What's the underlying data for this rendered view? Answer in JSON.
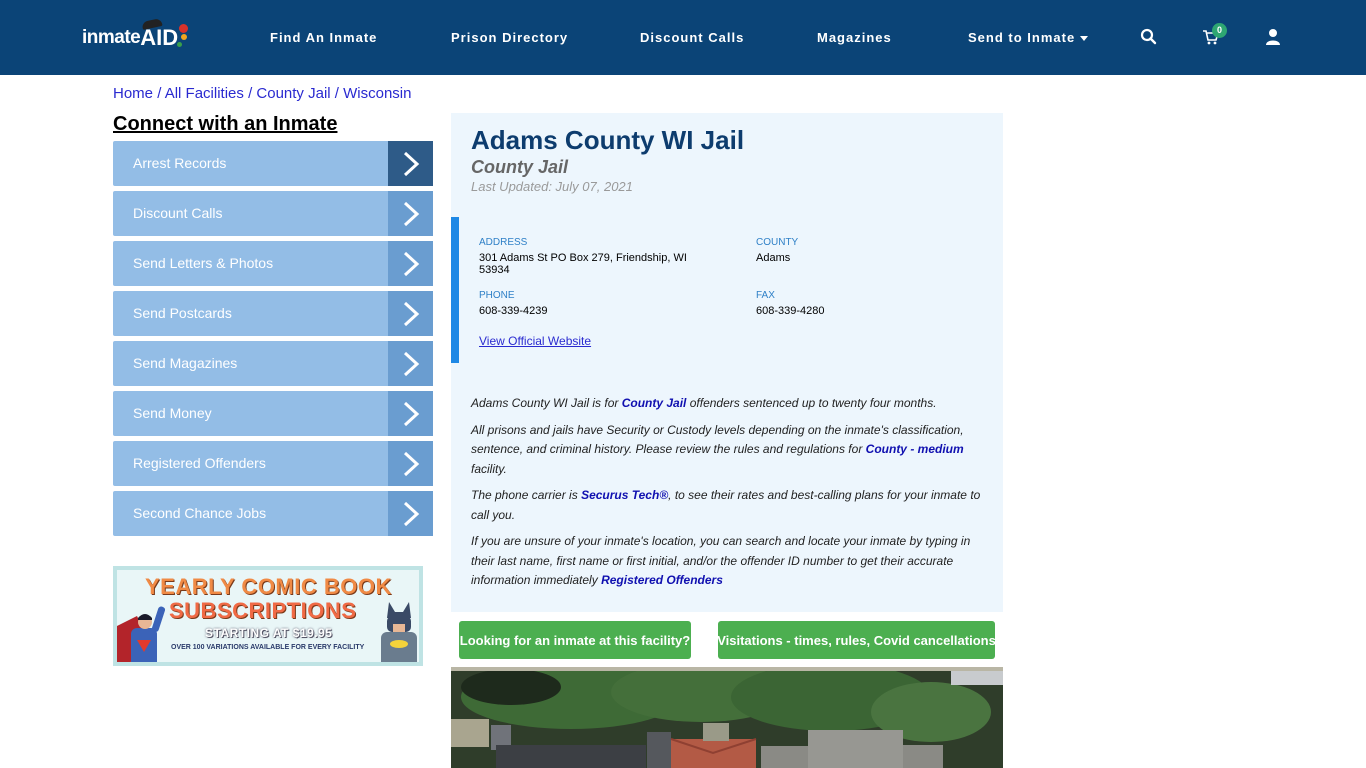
{
  "header": {
    "logo": {
      "text_main": "inmate",
      "text_accent": "AID"
    },
    "nav": [
      {
        "label": "Find An Inmate"
      },
      {
        "label": "Prison Directory"
      },
      {
        "label": "Discount Calls"
      },
      {
        "label": "Magazines"
      },
      {
        "label": "Send to Inmate",
        "has_dropdown": true
      }
    ],
    "icons": {
      "search": "search-icon",
      "cart": "cart-icon",
      "user": "user-icon"
    },
    "cart_count": "0"
  },
  "breadcrumb": [
    {
      "label": "Home"
    },
    {
      "label": "All Facilities"
    },
    {
      "label": "County Jail"
    },
    {
      "label": "Wisconsin"
    }
  ],
  "breadcrumb_separator": "/",
  "sidebar": {
    "title": "Connect with an Inmate",
    "items": [
      {
        "label": "Arrest Records",
        "icon": "chevron-right-icon"
      },
      {
        "label": "Discount Calls",
        "icon": "chevron-right-icon"
      },
      {
        "label": "Send Letters & Photos",
        "icon": "chevron-right-icon"
      },
      {
        "label": "Send Postcards",
        "icon": "chevron-right-icon"
      },
      {
        "label": "Send Magazines",
        "icon": "chevron-right-icon"
      },
      {
        "label": "Send Money",
        "icon": "chevron-right-icon"
      },
      {
        "label": "Registered Offenders",
        "icon": "chevron-right-icon"
      },
      {
        "label": "Second Chance Jobs",
        "icon": "chevron-right-icon"
      }
    ],
    "ad": {
      "line1": "YEARLY COMIC BOOK",
      "line2": "SUBSCRIPTIONS",
      "line3": "STARTING AT $19.95",
      "line4": "OVER 100 VARIATIONS AVAILABLE FOR EVERY FACILITY"
    }
  },
  "facility": {
    "name": "Adams County WI Jail",
    "type": "County Jail",
    "last_updated": "Last Updated: July 07, 2021",
    "address_label": "ADDRESS",
    "address_line1": "301 Adams St PO Box 279, Friendship, WI",
    "address_line2": "53934",
    "county_label": "COUNTY",
    "county": "Adams",
    "phone_label": "PHONE",
    "phone": "608-339-4239",
    "fax_label": "FAX",
    "fax": "608-339-4280",
    "website_link": "View Official Website"
  },
  "description": {
    "p1": {
      "a": "Adams County WI Jail is for ",
      "link": "County Jail",
      "b": " offenders sentenced up to twenty four months."
    },
    "p2": {
      "a": "All prisons and jails have Security or Custody levels depending on the inmate's classification, sentence, and criminal history. Please review the rules and regulations for ",
      "link": "County - medium",
      "b": " facility."
    },
    "p3": {
      "a": "The phone carrier is ",
      "link": "Securus Tech®",
      "b": ", to see their rates and best-calling plans for your inmate to call you."
    },
    "p4": {
      "a": "If you are unsure of your inmate's location, you can search and locate your inmate by typing in their last name, first name or first initial, and/or the offender ID number to get their accurate information immediately ",
      "link": "Registered Offenders",
      "b": ""
    }
  },
  "actions": {
    "find_inmate": "Looking for an inmate at this facility?",
    "visitations": "Visitations - times, rules, Covid cancellations"
  },
  "colors": {
    "navbar": "#0b4477",
    "sidebar_item": "#93bde6",
    "sidebar_arrow": "#6a9dd0",
    "sidebar_arrow_active": "#2e5b88",
    "panel_bg": "#edf6fd",
    "accent_bar": "#1e88e5",
    "title": "#0d3c6e",
    "button_green": "#4caf50",
    "cart_badge": "#2ea672"
  }
}
